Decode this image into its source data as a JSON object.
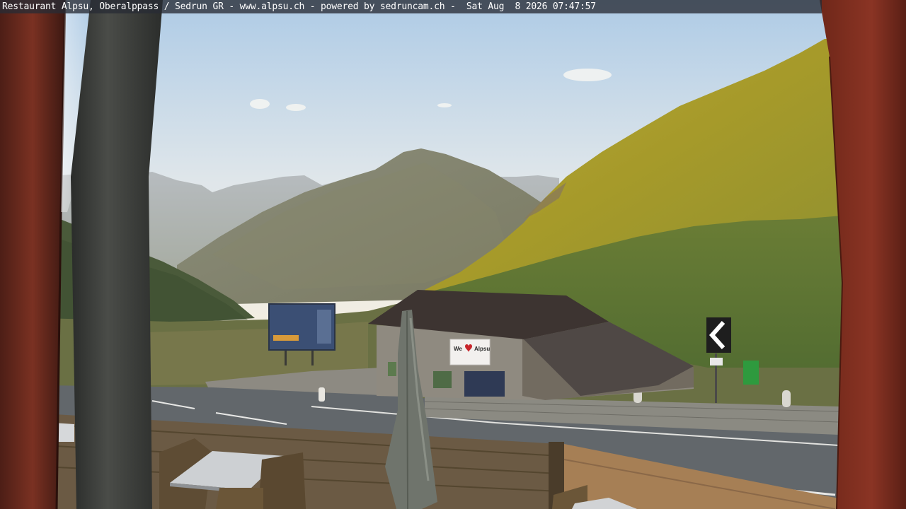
{
  "webcam": {
    "caption": "Restaurant Alpsu, Oberalppass / Sedrun GR - www.alpsu.ch - powered by sedruncam.ch -  Sat Aug  8 2026 07:47:57"
  },
  "banner": {
    "text_we": "We",
    "text_brand": "Alpsu"
  },
  "colors": {
    "sky_top": "#b9d0e6",
    "sky_bottom": "#ece9df",
    "sunlit_slope": "#b0a12c",
    "shadow_slope": "#5f7a3a",
    "frame_red": "#7a2a1c",
    "road": "#5f6468"
  }
}
